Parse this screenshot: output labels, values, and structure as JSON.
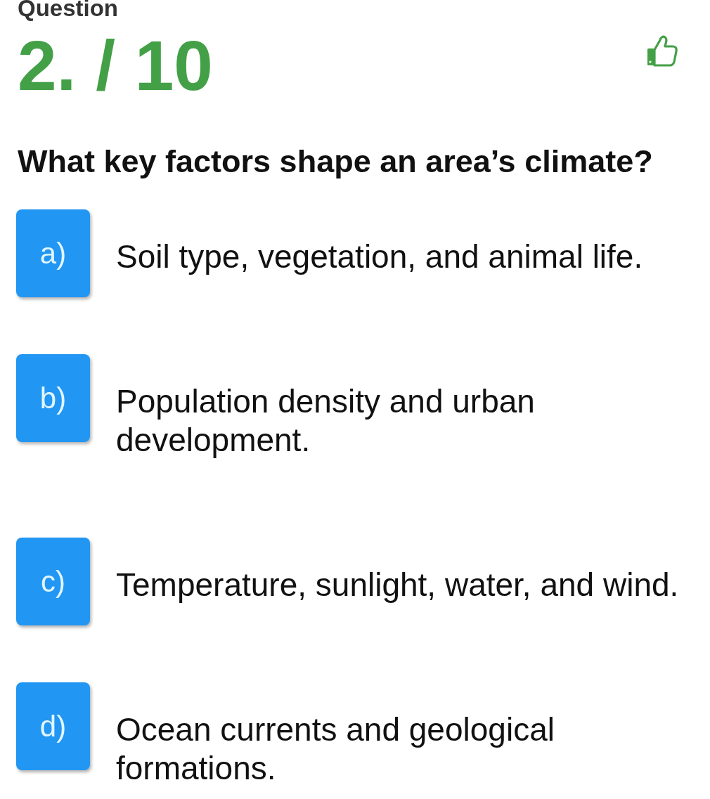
{
  "header": {
    "title": "Question",
    "counter": "2. / 10"
  },
  "question": "What key factors shape an area’s climate?",
  "options": [
    {
      "letter": "a)",
      "text": "Soil type, vegetation, and animal life."
    },
    {
      "letter": "b)",
      "text": "Population density and urban development."
    },
    {
      "letter": "c)",
      "text": "Temperature, sunlight, water, and wind."
    },
    {
      "letter": "d)",
      "text": "Ocean currents and geological formations."
    }
  ]
}
